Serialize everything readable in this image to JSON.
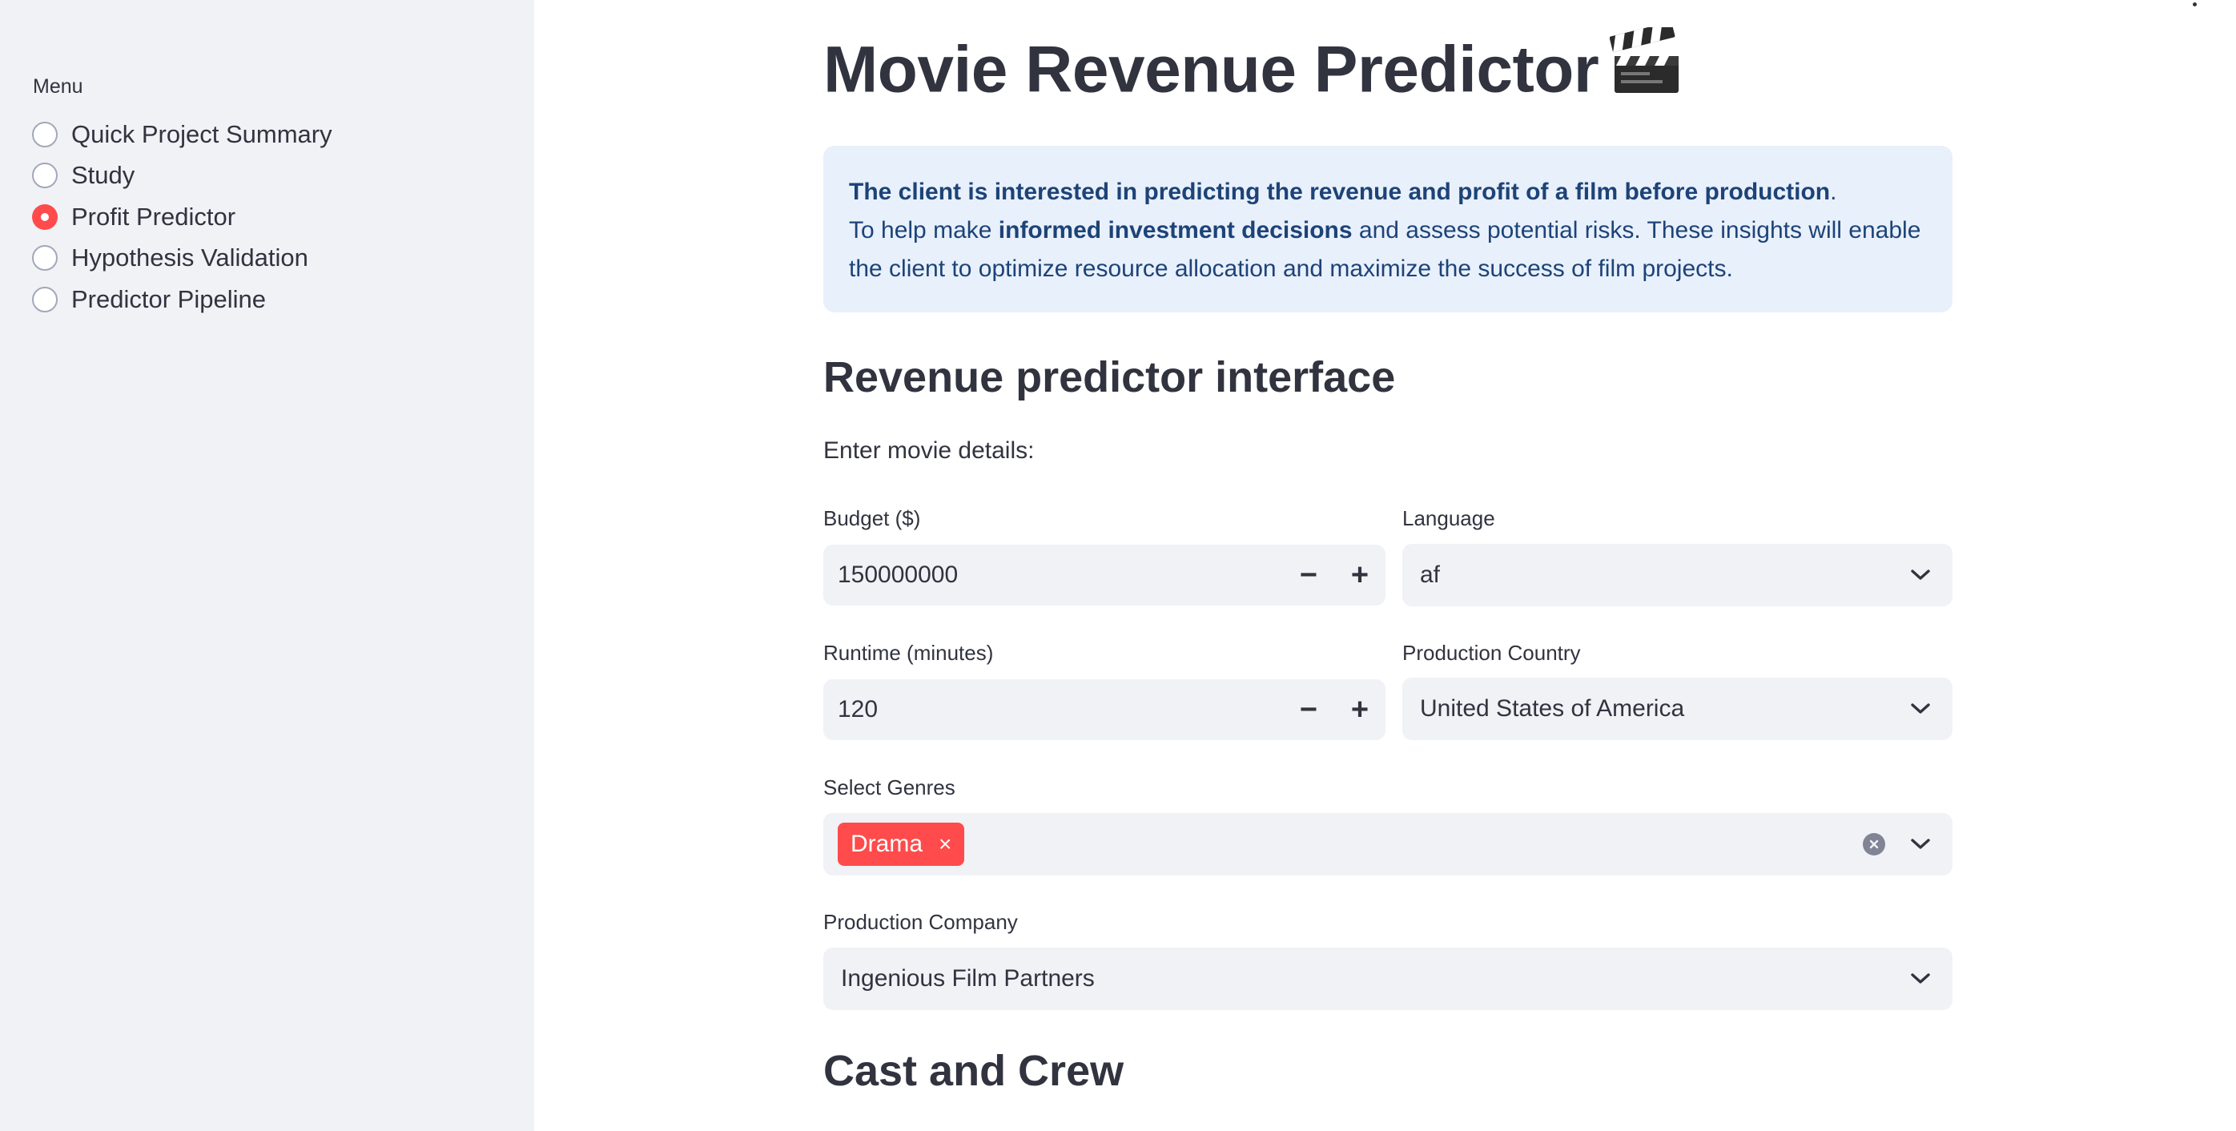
{
  "sidebar": {
    "menu_label": "Menu",
    "items": [
      {
        "label": "Quick Project Summary",
        "checked": false
      },
      {
        "label": "Study",
        "checked": false
      },
      {
        "label": "Profit Predictor",
        "checked": true
      },
      {
        "label": "Hypothesis Validation",
        "checked": false
      },
      {
        "label": "Predictor Pipeline",
        "checked": false
      }
    ]
  },
  "main": {
    "title": "Movie Revenue Predictor",
    "title_icon": "clapperboard-icon",
    "info": {
      "line1_bold": "The client is interested in predicting the revenue and profit of a film before production",
      "line1_end": ".",
      "line2_pre": "To help make ",
      "line2_bold": "informed investment decisions",
      "line2_post": " and assess potential risks. These insights will enable",
      "line3": "the client to optimize resource allocation and maximize the success of film projects."
    },
    "section_title": "Revenue predictor interface",
    "enter_details": "Enter movie details:",
    "budget": {
      "label": "Budget ($)",
      "value": "150000000",
      "minus": "−",
      "plus": "+"
    },
    "language": {
      "label": "Language",
      "value": "af"
    },
    "runtime": {
      "label": "Runtime (minutes)",
      "value": "120",
      "minus": "−",
      "plus": "+"
    },
    "country": {
      "label": "Production Country",
      "value": "United States of America"
    },
    "genres": {
      "label": "Select Genres",
      "selected": [
        "Drama"
      ],
      "remove_glyph": "×"
    },
    "company": {
      "label": "Production Company",
      "value": "Ingenious Film Partners"
    },
    "cast_title": "Cast and Crew"
  },
  "colors": {
    "accent": "#ff4b4b",
    "sidebar_bg": "#f0f2f6",
    "info_bg": "#e8f0fb",
    "info_text": "#1d4378",
    "text": "#31333f"
  }
}
